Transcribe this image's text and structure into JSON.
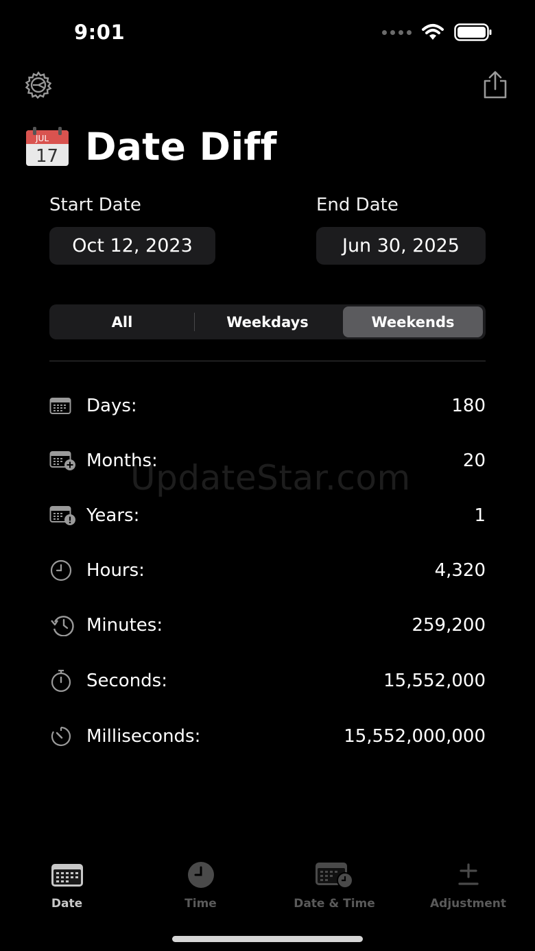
{
  "status_bar": {
    "time": "9:01"
  },
  "header": {
    "title": "Date Diff",
    "calendar_month": "JUL",
    "calendar_day": "17"
  },
  "dates": {
    "start_label": "Start Date",
    "start_value": "Oct 12, 2023",
    "end_label": "End Date",
    "end_value": "Jun 30, 2025"
  },
  "segments": {
    "items": [
      "All",
      "Weekdays",
      "Weekends"
    ],
    "selected": "Weekends"
  },
  "results": [
    {
      "label": "Days:",
      "value": "180",
      "icon": "calendar-icon"
    },
    {
      "label": "Months:",
      "value": "20",
      "icon": "calendar-plus-icon"
    },
    {
      "label": "Years:",
      "value": "1",
      "icon": "calendar-badge-icon"
    },
    {
      "label": "Hours:",
      "value": "4,320",
      "icon": "clock-icon"
    },
    {
      "label": "Minutes:",
      "value": "259,200",
      "icon": "clock-history-icon"
    },
    {
      "label": "Seconds:",
      "value": "15,552,000",
      "icon": "stopwatch-icon"
    },
    {
      "label": "Milliseconds:",
      "value": "15,552,000,000",
      "icon": "timer-icon"
    }
  ],
  "watermark": "UpdateStar.com",
  "tab_bar": {
    "items": [
      {
        "label": "Date",
        "icon": "calendar-icon",
        "active": true
      },
      {
        "label": "Time",
        "icon": "clock-icon",
        "active": false
      },
      {
        "label": "Date & Time",
        "icon": "calendar-clock-icon",
        "active": false
      },
      {
        "label": "Adjustment",
        "icon": "plus-minus-icon",
        "active": false
      }
    ]
  }
}
